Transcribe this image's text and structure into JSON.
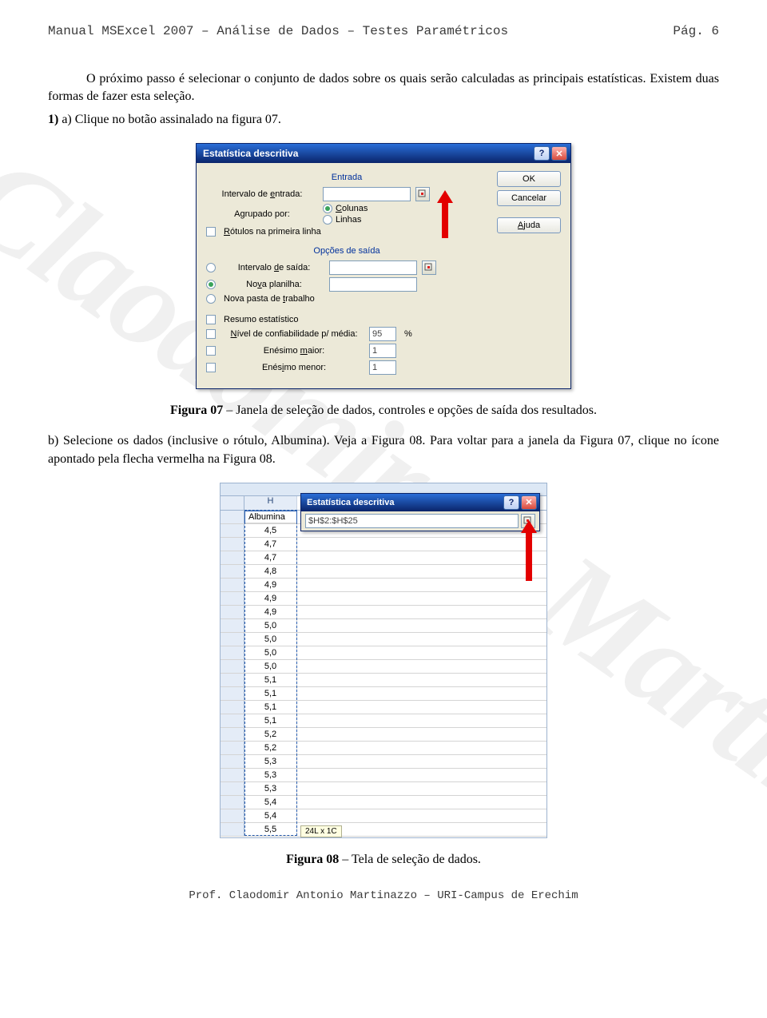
{
  "header": {
    "left": "Manual MSExcel 2007 – Análise de Dados – Testes Paramétricos",
    "right": "Pág.    6"
  },
  "watermark": "Prof. Claodomir A. Martinazzo",
  "para1": "O próximo passo é selecionar o conjunto de dados sobre os quais serão calculadas as principais estatísticas. Existem duas formas de fazer esta seleção.",
  "para2_label": "1)",
  "para2": " a) Clique no botão assinalado na figura 07.",
  "caption1_bold": "Figura 07",
  "caption1_rest": " – Janela de seleção de dados, controles e opções de saída dos resultados.",
  "para3": "b) Selecione os dados (inclusive o rótulo, Albumina). Veja a Figura 08. Para voltar para a janela da Figura 07, clique no ícone apontado pela flecha vermelha na Figura 08.",
  "caption2_bold": "Figura 08",
  "caption2_rest": " – Tela de seleção de dados.",
  "footer": "Prof. Claodomir Antonio Martinazzo – URI-Campus de Erechim",
  "dialog": {
    "title": "Estatística descritiva",
    "help_btn": "?",
    "close_btn": "✕",
    "entrada_label": "Entrada",
    "intervalo_entrada": "Intervalo de entrada:",
    "agrupado": "Agrupado por:",
    "colunas": "Colunas",
    "linhas": "Linhas",
    "rotulos": "Rótulos na primeira linha",
    "opcoes_label": "Opções de saída",
    "intervalo_saida": "Intervalo de saída:",
    "nova_planilha": "Nova planilha:",
    "nova_pasta": "Nova pasta de trabalho",
    "resumo": "Resumo estatístico",
    "nivel": "Nível de confiabilidade p/ média:",
    "nivel_val": "95",
    "pct": "%",
    "maior": "Enésimo maior:",
    "maior_val": "1",
    "menor": "Enésimo menor:",
    "menor_val": "1",
    "ok": "OK",
    "cancelar": "Cancelar",
    "ajuda": "Ajuda"
  },
  "fig2": {
    "col": "H",
    "header_cell": "Albumina",
    "values": [
      "4,5",
      "4,7",
      "4,7",
      "4,8",
      "4,9",
      "4,9",
      "4,9",
      "5,0",
      "5,0",
      "5,0",
      "5,0",
      "5,1",
      "5,1",
      "5,1",
      "5,1",
      "5,2",
      "5,2",
      "5,3",
      "5,3",
      "5,3",
      "5,4",
      "5,4",
      "5,5"
    ],
    "collapsed_title": "Estatística descritiva",
    "collapsed_value": "$H$2:$H$25",
    "selection_info": "24L x 1C"
  }
}
